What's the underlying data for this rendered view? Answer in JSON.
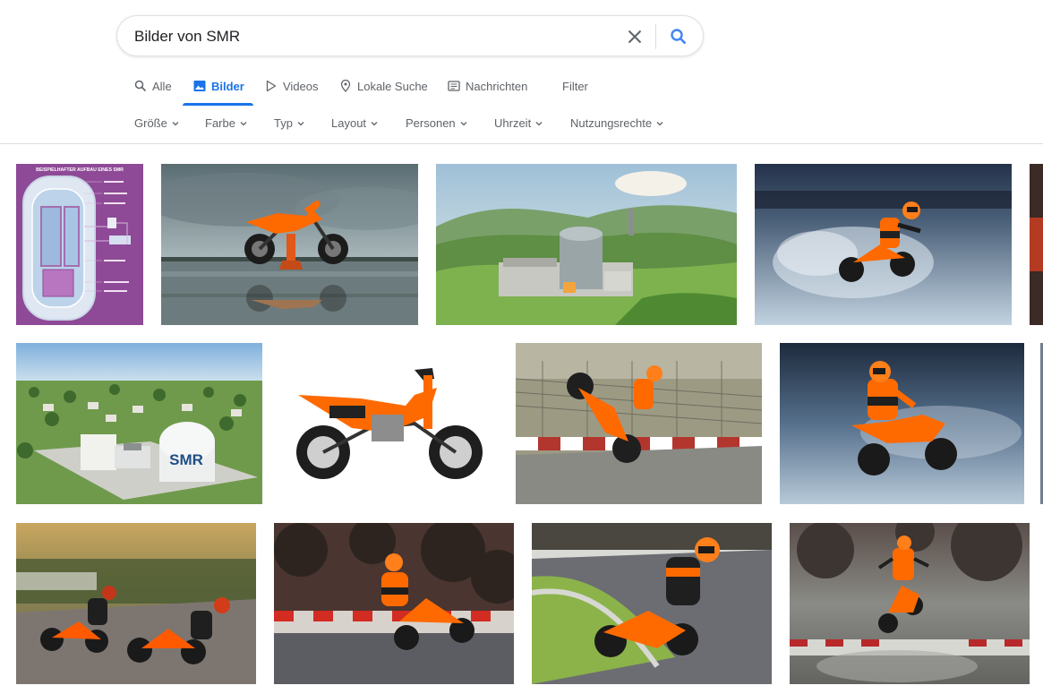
{
  "search": {
    "query": "Bilder von SMR"
  },
  "tabs": [
    {
      "label": "Alle",
      "icon": "search-icon"
    },
    {
      "label": "Bilder",
      "icon": "image-icon",
      "active": true
    },
    {
      "label": "Videos",
      "icon": "play-icon"
    },
    {
      "label": "Lokale Suche",
      "icon": "pin-icon"
    },
    {
      "label": "Nachrichten",
      "icon": "news-icon"
    },
    {
      "label": "Filter"
    }
  ],
  "filters": [
    "Größe",
    "Farbe",
    "Typ",
    "Layout",
    "Personen",
    "Uhrzeit",
    "Nutzungsrechte"
  ],
  "colors": {
    "accent": "#1a73e8",
    "text_secondary": "#5f6368",
    "ktm_orange": "#ff6a00"
  },
  "diagram_title": "BEISPIELHAFTER AUFBAU EINES SMR",
  "smr_label": "SMR",
  "results": [
    {
      "subject": "smr-diagram"
    },
    {
      "subject": "ktm-bike-on-stand-lake"
    },
    {
      "subject": "reactor-green-valley"
    },
    {
      "subject": "rider-on-ice"
    },
    {
      "subject": "smr-building-village"
    },
    {
      "subject": "ktm-bike-studio"
    },
    {
      "subject": "rider-wheelie"
    },
    {
      "subject": "rider-wet-track"
    },
    {
      "subject": "two-riders-track"
    },
    {
      "subject": "rider-kerb-corner"
    },
    {
      "subject": "rider-knee-down"
    },
    {
      "subject": "rider-jump"
    }
  ]
}
